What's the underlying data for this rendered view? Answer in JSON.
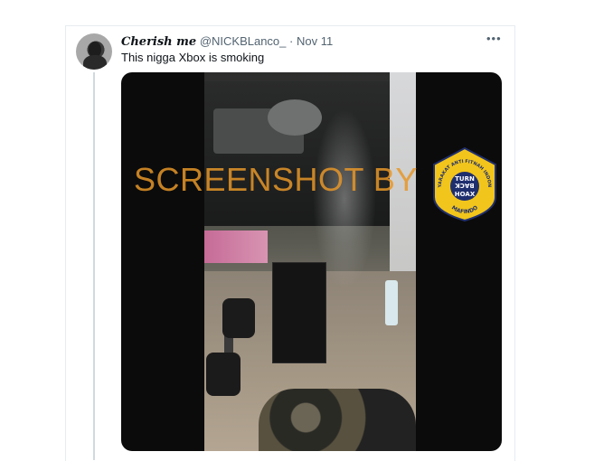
{
  "tweet": {
    "display_name": "Cherish me",
    "handle": "@NICKBLanco_",
    "separator": "·",
    "date": "Nov 11",
    "more_label": "•••",
    "text": "This nigga Xbox is smoking"
  },
  "media": {
    "watermark_text": "SCREENSHOT BY",
    "badge": {
      "center_text_lines": [
        "TURN",
        "BACK",
        "HOAX"
      ],
      "ring_text_top": "MASYARAKAT ANTI FITNAH INDONESIA",
      "ring_text_bottom": "MAFINDO"
    }
  },
  "colors": {
    "badge_yellow": "#f2c51c",
    "badge_navy": "#1f2f6e",
    "watermark_orange": "#e69628"
  }
}
